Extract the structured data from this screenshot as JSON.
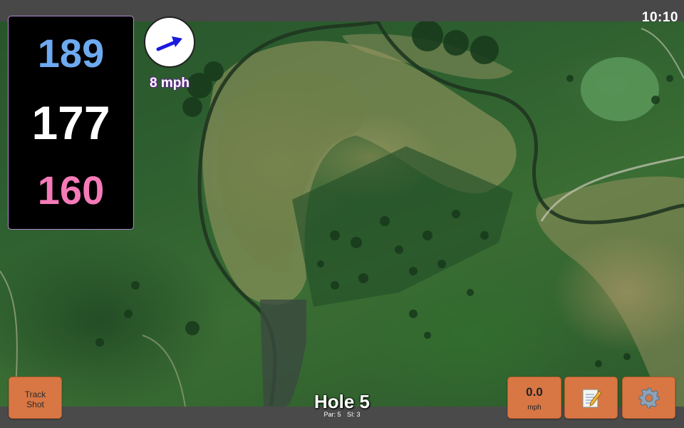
{
  "status": {
    "time": "10:10"
  },
  "distances": {
    "back": "189",
    "middle": "177",
    "front": "160"
  },
  "wind": {
    "speed": "8 mph",
    "icon": "wind-direction-arrow-icon"
  },
  "hole": {
    "title": "Hole 5",
    "par": "Par: 5",
    "si": "SI: 3"
  },
  "buttons": {
    "track_shot": "Track\nShot",
    "speed_value": "0.0",
    "speed_unit": "mph",
    "notes_icon": "notepad-icon",
    "settings_icon": "gear-icon"
  },
  "colors": {
    "button": "#d87744",
    "back_distance": "#6eaaf0",
    "middle_distance": "#ffffff",
    "front_distance": "#f57ab8",
    "wind_arrow": "#1a1adf"
  }
}
